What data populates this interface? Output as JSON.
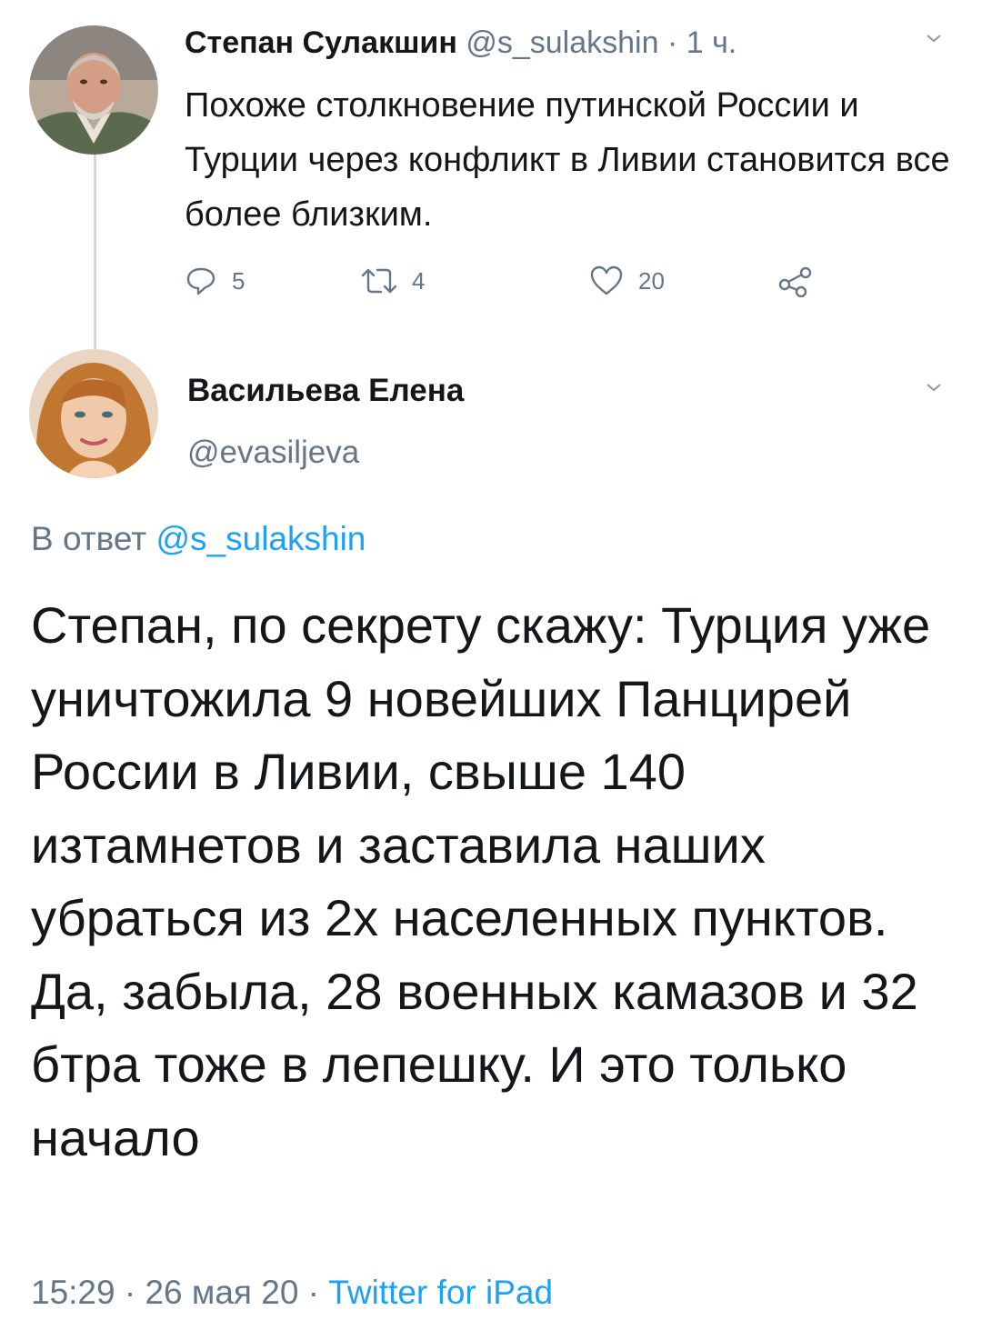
{
  "parent_tweet": {
    "author_name": "Степан Сулакшин",
    "author_handle": "@s_sulakshin",
    "separator": "·",
    "time": "1 ч.",
    "text": "Похоже столкновение путинской России и Турции через конфликт в Ливии становится все более близким.",
    "replies": "5",
    "retweets": "4",
    "likes": "20",
    "icons": [
      "reply-icon",
      "retweet-icon",
      "like-icon",
      "share-icon",
      "chevron-down-icon"
    ]
  },
  "reply_tweet": {
    "author_name": "Васильева Елена",
    "author_handle": "@evasiljeva",
    "reply_prefix": "В ответ",
    "reply_handle": "@s_sulakshin",
    "text": "Степан, по секрету скажу: Турция уже уничтожила 9 новейших Панцирей России в Ливии, свыше 140 изтамнетов и заставила наших убраться из 2х населенных пунктов. Да, забыла, 28 военных камазов и 32 бтра тоже в лепешку. И это только начало",
    "time": "15:29",
    "separator": "·",
    "date": "26 мая 20",
    "separator2": "·",
    "source": "Twitter for iPad"
  },
  "colors": {
    "link": "#1da1f2",
    "secondary_text": "#657786",
    "primary_text": "#14171a",
    "thread_line": "#cfd9de"
  }
}
